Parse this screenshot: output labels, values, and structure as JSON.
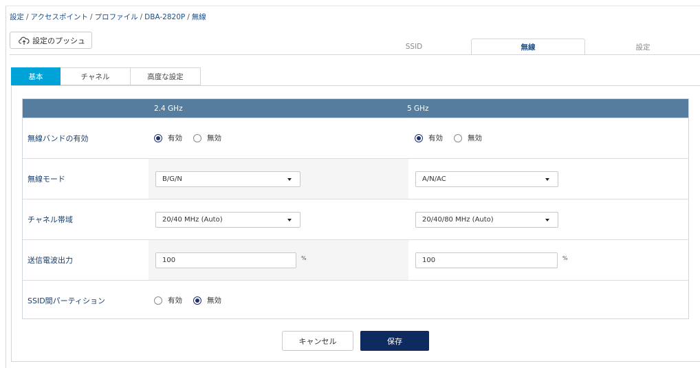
{
  "breadcrumb": {
    "items": [
      "設定",
      "アクセスポイント",
      "プロファイル",
      "DBA-2820P",
      "無線"
    ],
    "separator": "/"
  },
  "toolbar": {
    "push_label": "設定のプッシュ",
    "push_icon": "cloud-upload-icon"
  },
  "main_tabs": [
    {
      "label": "SSID",
      "active": false
    },
    {
      "label": "無線",
      "active": true
    },
    {
      "label": "設定",
      "active": false
    }
  ],
  "sub_tabs": [
    {
      "label": "基本",
      "active": true
    },
    {
      "label": "チャネル",
      "active": false
    },
    {
      "label": "高度な設定",
      "active": false
    }
  ],
  "table": {
    "columns": [
      "2.4 GHz",
      "5 GHz"
    ],
    "rows": {
      "band_enable": {
        "label": "無線バンドの有効",
        "g24": {
          "options": [
            "有効",
            "無効"
          ],
          "selected": "有効"
        },
        "g5": {
          "options": [
            "有効",
            "無効"
          ],
          "selected": "有効"
        }
      },
      "mode": {
        "label": "無線モード",
        "g24": "B/G/N",
        "g5": "A/N/AC"
      },
      "channel_width": {
        "label": "チャネル帯域",
        "g24": "20/40 MHz (Auto)",
        "g5": "20/40/80 MHz (Auto)"
      },
      "tx_power": {
        "label": "送信電波出力",
        "g24": "100",
        "g5": "100",
        "unit": "%"
      },
      "ssid_partition": {
        "label": "SSID間パーティション",
        "options": [
          "有効",
          "無効"
        ],
        "selected": "無効"
      }
    }
  },
  "actions": {
    "cancel_label": "キャンセル",
    "save_label": "保存"
  },
  "colors": {
    "accent": "#00a3d8",
    "header": "#567c9e",
    "primary_button": "#0f2a5f",
    "link": "#1a4f8c"
  }
}
